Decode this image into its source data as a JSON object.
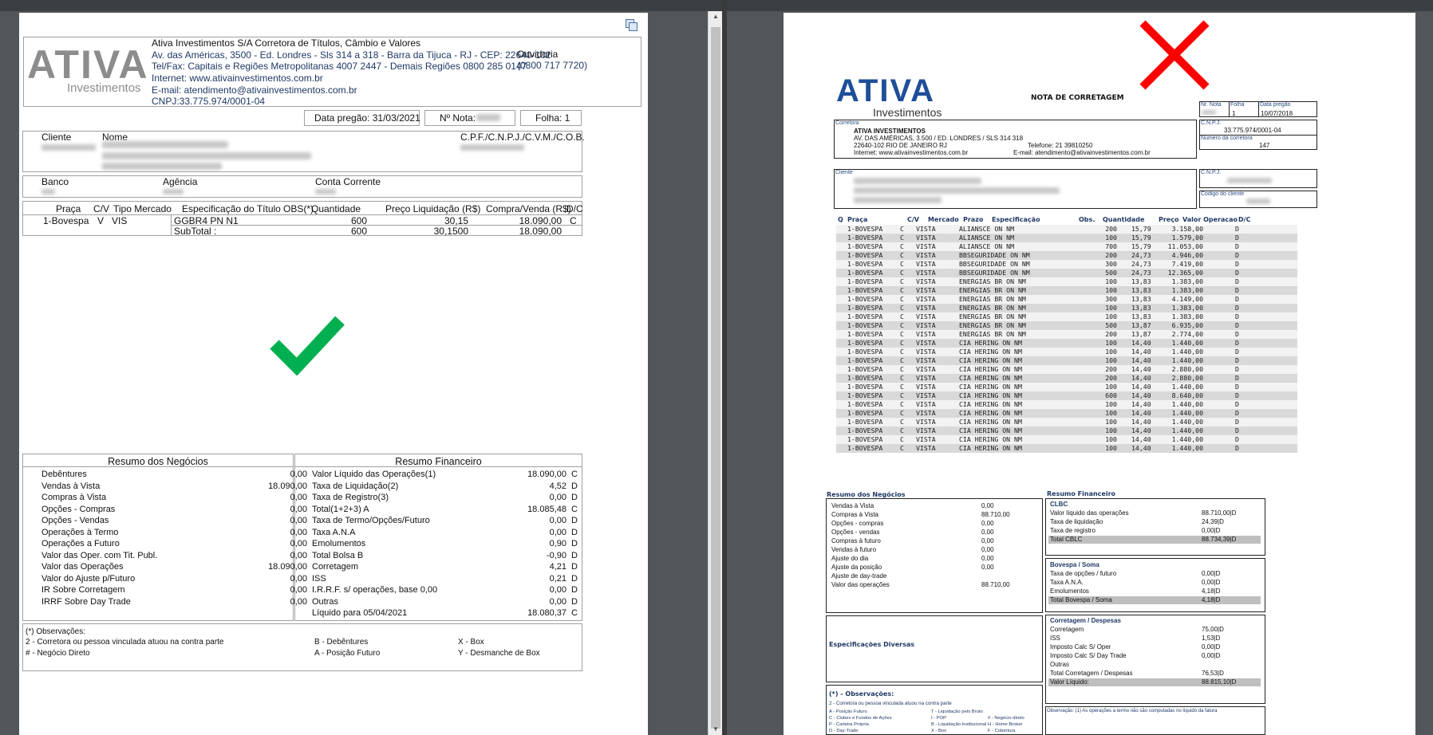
{
  "left": {
    "company": "Ativa Investimentos S/A Corretora de Títulos, Câmbio e Valores",
    "address": "Av. das Américas, 3500 - Ed. Londres - Sls 314 a 318 - Barra da Tijuca - RJ - CEP: 22640-102",
    "tel": "Tel/Fax: Capitais e Regiões Metropolitanas 4007 2447 - Demais Regiões 0800 285 0147",
    "internet": "Internet:  www.ativainvestimentos.com.br",
    "email": "E-mail:  atendimento@ativainvestimentos.com.br",
    "cnpj": "CNPJ:33.775.974/0001-04",
    "ouvidoria": "Ouvidoria",
    "ouvidoria_phone": "(0800 717 7720)",
    "logo_text": "ATIVA",
    "logo_sub": "Investimentos",
    "data_pregao": "Data pregão: 31/03/2021",
    "nota": "Nº Nota:",
    "folha": "Folha: 1",
    "cliente": "Cliente",
    "nome": "Nome",
    "cpf": "C.P.F./C.N.P.J./C.V.M./C.O.B.",
    "banco": "Banco",
    "agencia": "Agência",
    "conta": "Conta Corrente",
    "cols": [
      "Praça",
      "C/V",
      "Tipo Mercado",
      "Especificação do Título",
      "OBS(*)",
      "Quantidade",
      "Preço Liquidação (R$)",
      "Compra/Venda (R$)",
      "D/C"
    ],
    "row": [
      "1-Bovespa",
      "V",
      "VIS",
      "GGBR4 PN N1",
      "",
      "600",
      "30,15",
      "18.090,00",
      "C"
    ],
    "subtotal": [
      "SubTotal :",
      "600",
      "30,1500",
      "18.090,00"
    ],
    "resumo_neg_title": "Resumo dos Negócios",
    "resumo_neg": [
      [
        "Debêntures",
        "0,00"
      ],
      [
        "Vendas à Vista",
        "18.090,00"
      ],
      [
        "Compras à Vista",
        "0,00"
      ],
      [
        "Opções - Compras",
        "0,00"
      ],
      [
        "Opções - Vendas",
        "0,00"
      ],
      [
        "Operações à Termo",
        "0,00"
      ],
      [
        "Operações a Futuro",
        "0,00"
      ],
      [
        "Valor das Oper. com Tit. Publ.",
        "0,00"
      ],
      [
        "Valor das Operações",
        "18.090,00"
      ],
      [
        "Valor do Ajuste p/Futuro",
        "0,00"
      ],
      [
        "IR Sobre Corretagem",
        "0,00"
      ],
      [
        "IRRF Sobre Day Trade",
        "0,00"
      ]
    ],
    "resumo_fin_title": "Resumo Financeiro",
    "resumo_fin": [
      [
        "Valor Líquido das Operações(1)",
        "18.090,00",
        "C"
      ],
      [
        "Taxa de Liquidação(2)",
        "4,52",
        "D"
      ],
      [
        "Taxa de Registro(3)",
        "0,00",
        "D"
      ],
      [
        "Total(1+2+3) A",
        "18.085,48",
        "C"
      ],
      [
        "Taxa de Termo/Opções/Futuro",
        "0,00",
        "D"
      ],
      [
        "Taxa A.N.A",
        "0,00",
        "D"
      ],
      [
        "Emolumentos",
        "0,90",
        "D"
      ],
      [
        "Total Bolsa B",
        "-0,90",
        "D"
      ],
      [
        "Corretagem",
        "4,21",
        "D"
      ],
      [
        "ISS",
        "0,21",
        "D"
      ],
      [
        "I.R.R.F. s/ operações, base 0,00",
        "0,00",
        "D"
      ],
      [
        "Outras",
        "0,00",
        "D"
      ],
      [
        "Líquido para 05/04/2021",
        "18.080,37",
        "C"
      ]
    ],
    "obs_title": "(*) Observações:",
    "obs": [
      "2 - Corretora ou pessoa vinculada atuou na contra parte",
      "B - Debêntures",
      "X - Box",
      "# - Negócio Direto",
      "A - Posição Futuro",
      "Y - Desmanche de Box"
    ]
  },
  "right": {
    "logo_text": "ATIVA",
    "logo_sub": "Investimentos",
    "title": "NOTA DE CORRETAGEM",
    "nr_nota": "Nr. Nota",
    "folha": "Folha",
    "folha_val": "1",
    "data_pregao": "Data pregão",
    "data_val": "10/07/2018",
    "cnpj_lbl": "C.N.P.J.",
    "cnpj_val": "33.775.974/0001-04",
    "num_corr_lbl": "Número da corretora",
    "num_corr": "147",
    "corretora_lbl": "Corretora",
    "corretora": "ATIVA INVESTIMENTOS",
    "c_addr": "AV. DAS AMÉRICAS, 3.500 / ED. LONDRES / SLS 314 318",
    "c_cep": "22640-102 RIO DE JANEIRO RJ",
    "c_tel": "Telefone: 21 39810250",
    "c_internet": "Internet: www.ativainvestimentos.com.br",
    "c_email": "E-mail: atendimento@ativainvestimentos.com.br",
    "cliente_lbl": "Cliente",
    "cnpj2_lbl": "C.N.P.J.",
    "cod_cliente_lbl": "Código do cliente",
    "cols": [
      "Q",
      "Praça",
      "C/V",
      "Mercado",
      "Prazo",
      "Especificação",
      "Obs.",
      "Quantidade",
      "Preço",
      "Valor Operacao",
      "D/C"
    ],
    "rows": [
      [
        "1-BOVESPA",
        "C",
        "VISTA",
        "ALIANSCE ON NM",
        "200",
        "15,79",
        "3.158,00",
        "D"
      ],
      [
        "1-BOVESPA",
        "C",
        "VISTA",
        "ALIANSCE ON NM",
        "100",
        "15,79",
        "1.579,00",
        "D"
      ],
      [
        "1-BOVESPA",
        "C",
        "VISTA",
        "ALIANSCE ON NM",
        "700",
        "15,79",
        "11.053,00",
        "D"
      ],
      [
        "1-BOVESPA",
        "C",
        "VISTA",
        "BBSEGURIDADE ON NM",
        "200",
        "24,73",
        "4.946,00",
        "D"
      ],
      [
        "1-BOVESPA",
        "C",
        "VISTA",
        "BBSEGURIDADE ON NM",
        "300",
        "24,73",
        "7.419,00",
        "D"
      ],
      [
        "1-BOVESPA",
        "C",
        "VISTA",
        "BBSEGURIDADE ON NM",
        "500",
        "24,73",
        "12.365,00",
        "D"
      ],
      [
        "1-BOVESPA",
        "C",
        "VISTA",
        "ENERGIAS BR ON NM",
        "100",
        "13,83",
        "1.383,00",
        "D"
      ],
      [
        "1-BOVESPA",
        "C",
        "VISTA",
        "ENERGIAS BR ON NM",
        "100",
        "13,83",
        "1.383,00",
        "D"
      ],
      [
        "1-BOVESPA",
        "C",
        "VISTA",
        "ENERGIAS BR ON NM",
        "300",
        "13,83",
        "4.149,00",
        "D"
      ],
      [
        "1-BOVESPA",
        "C",
        "VISTA",
        "ENERGIAS BR ON NM",
        "100",
        "13,83",
        "1.383,00",
        "D"
      ],
      [
        "1-BOVESPA",
        "C",
        "VISTA",
        "ENERGIAS BR ON NM",
        "100",
        "13,83",
        "1.383,00",
        "D"
      ],
      [
        "1-BOVESPA",
        "C",
        "VISTA",
        "ENERGIAS BR ON NM",
        "500",
        "13,87",
        "6.935,00",
        "D"
      ],
      [
        "1-BOVESPA",
        "C",
        "VISTA",
        "ENERGIAS BR ON NM",
        "200",
        "13,87",
        "2.774,00",
        "D"
      ],
      [
        "1-BOVESPA",
        "C",
        "VISTA",
        "CIA HERING ON NM",
        "100",
        "14,40",
        "1.440,00",
        "D"
      ],
      [
        "1-BOVESPA",
        "C",
        "VISTA",
        "CIA HERING ON NM",
        "100",
        "14,40",
        "1.440,00",
        "D"
      ],
      [
        "1-BOVESPA",
        "C",
        "VISTA",
        "CIA HERING ON NM",
        "100",
        "14,40",
        "1.440,00",
        "D"
      ],
      [
        "1-BOVESPA",
        "C",
        "VISTA",
        "CIA HERING ON NM",
        "200",
        "14,40",
        "2.880,00",
        "D"
      ],
      [
        "1-BOVESPA",
        "C",
        "VISTA",
        "CIA HERING ON NM",
        "200",
        "14,40",
        "2.880,00",
        "D"
      ],
      [
        "1-BOVESPA",
        "C",
        "VISTA",
        "CIA HERING ON NM",
        "100",
        "14,40",
        "1.440,00",
        "D"
      ],
      [
        "1-BOVESPA",
        "C",
        "VISTA",
        "CIA HERING ON NM",
        "600",
        "14,40",
        "8.640,00",
        "D"
      ],
      [
        "1-BOVESPA",
        "C",
        "VISTA",
        "CIA HERING ON NM",
        "100",
        "14,40",
        "1.440,00",
        "D"
      ],
      [
        "1-BOVESPA",
        "C",
        "VISTA",
        "CIA HERING ON NM",
        "100",
        "14,40",
        "1.440,00",
        "D"
      ],
      [
        "1-BOVESPA",
        "C",
        "VISTA",
        "CIA HERING ON NM",
        "100",
        "14,40",
        "1.440,00",
        "D"
      ],
      [
        "1-BOVESPA",
        "C",
        "VISTA",
        "CIA HERING ON NM",
        "100",
        "14,40",
        "1.440,00",
        "D"
      ],
      [
        "1-BOVESPA",
        "C",
        "VISTA",
        "CIA HERING ON NM",
        "100",
        "14,40",
        "1.440,00",
        "D"
      ],
      [
        "1-BOVESPA",
        "C",
        "VISTA",
        "CIA HERING ON NM",
        "100",
        "14,40",
        "1.440,00",
        "D"
      ]
    ],
    "resumo_neg_title": "Resumo dos Negócios",
    "resumo_neg": [
      [
        "Vendas à Vista",
        "0,00"
      ],
      [
        "Compras à Vista",
        "88.710,00"
      ],
      [
        "Opções - compras",
        "0,00"
      ],
      [
        "Opções - vendas",
        "0,00"
      ],
      [
        "Compras à futuro",
        "0,00"
      ],
      [
        "Vendas à futuro",
        "0,00"
      ],
      [
        "Ajuste do dia",
        "0,00"
      ],
      [
        "Ajuste da posição",
        "0,00"
      ],
      [
        "Ajuste de day-trade",
        ""
      ],
      [
        "Valor das operações",
        "88.710,00"
      ]
    ],
    "esp_diversas": "Especificações Diversas",
    "obs_title": "(*) - Observações:",
    "obs_line1": "2 - Corretora ou pessoa vinculada atuou na contra parte",
    "obs_grid": [
      [
        "A - Posição Futuro",
        "T - Liquidação pelo Bruto",
        ""
      ],
      [
        "C - Clubes e Fundos de Ações",
        "I - POP",
        "# - Negócio direto"
      ],
      [
        "P - Carteira Própria",
        "B - Liquidação Institucional",
        "H - Home Broker"
      ],
      [
        "D - Day-Trade",
        "X - Box",
        "F - Cobertura"
      ]
    ],
    "resumo_fin_title": "Resumo Financeiro",
    "clbc_title": "CLBC",
    "clbc": [
      [
        "Valor líquido das operações",
        "88.710,00|D"
      ],
      [
        "Taxa de liquidação",
        "24,39|D"
      ],
      [
        "Taxa de registro",
        "0,00|D"
      ]
    ],
    "clbc_total": [
      "Total CBLC",
      "88.734,39|D"
    ],
    "bov_title": "Bovespa / Soma",
    "bov": [
      [
        "Taxa de opções / futuro",
        "0,00|D"
      ],
      [
        "Taxa A.N.A.",
        "0,00|D"
      ],
      [
        "Emolumentos",
        "4,18|D"
      ]
    ],
    "bov_total": [
      "Total Bovespa / Soma",
      "4,18|D"
    ],
    "corr_title": "Corretagem / Despesas",
    "corr": [
      [
        "Corretagem",
        "75,00|D"
      ],
      [
        "ISS",
        "1,53|D"
      ],
      [
        "Imposto Calc S/ Oper",
        "0,00|D"
      ],
      [
        "Imposto Calc S/ Day Trade",
        "0,00|D"
      ],
      [
        "Outras",
        ""
      ],
      [
        "Total Corretagem / Despesas",
        "76,53|D"
      ]
    ],
    "liquido": [
      "Valor Líquido:",
      "88.815,10|D"
    ],
    "obs_right": "Observação: (1) As operações a termo não são computadas no líquido da fatura"
  },
  "colors": {
    "check": "#00b050",
    "cross": "#ff0000",
    "brand": "#1f3864",
    "logo_grey": "#8c8c8c",
    "logo_blue": "#1f4e99"
  }
}
